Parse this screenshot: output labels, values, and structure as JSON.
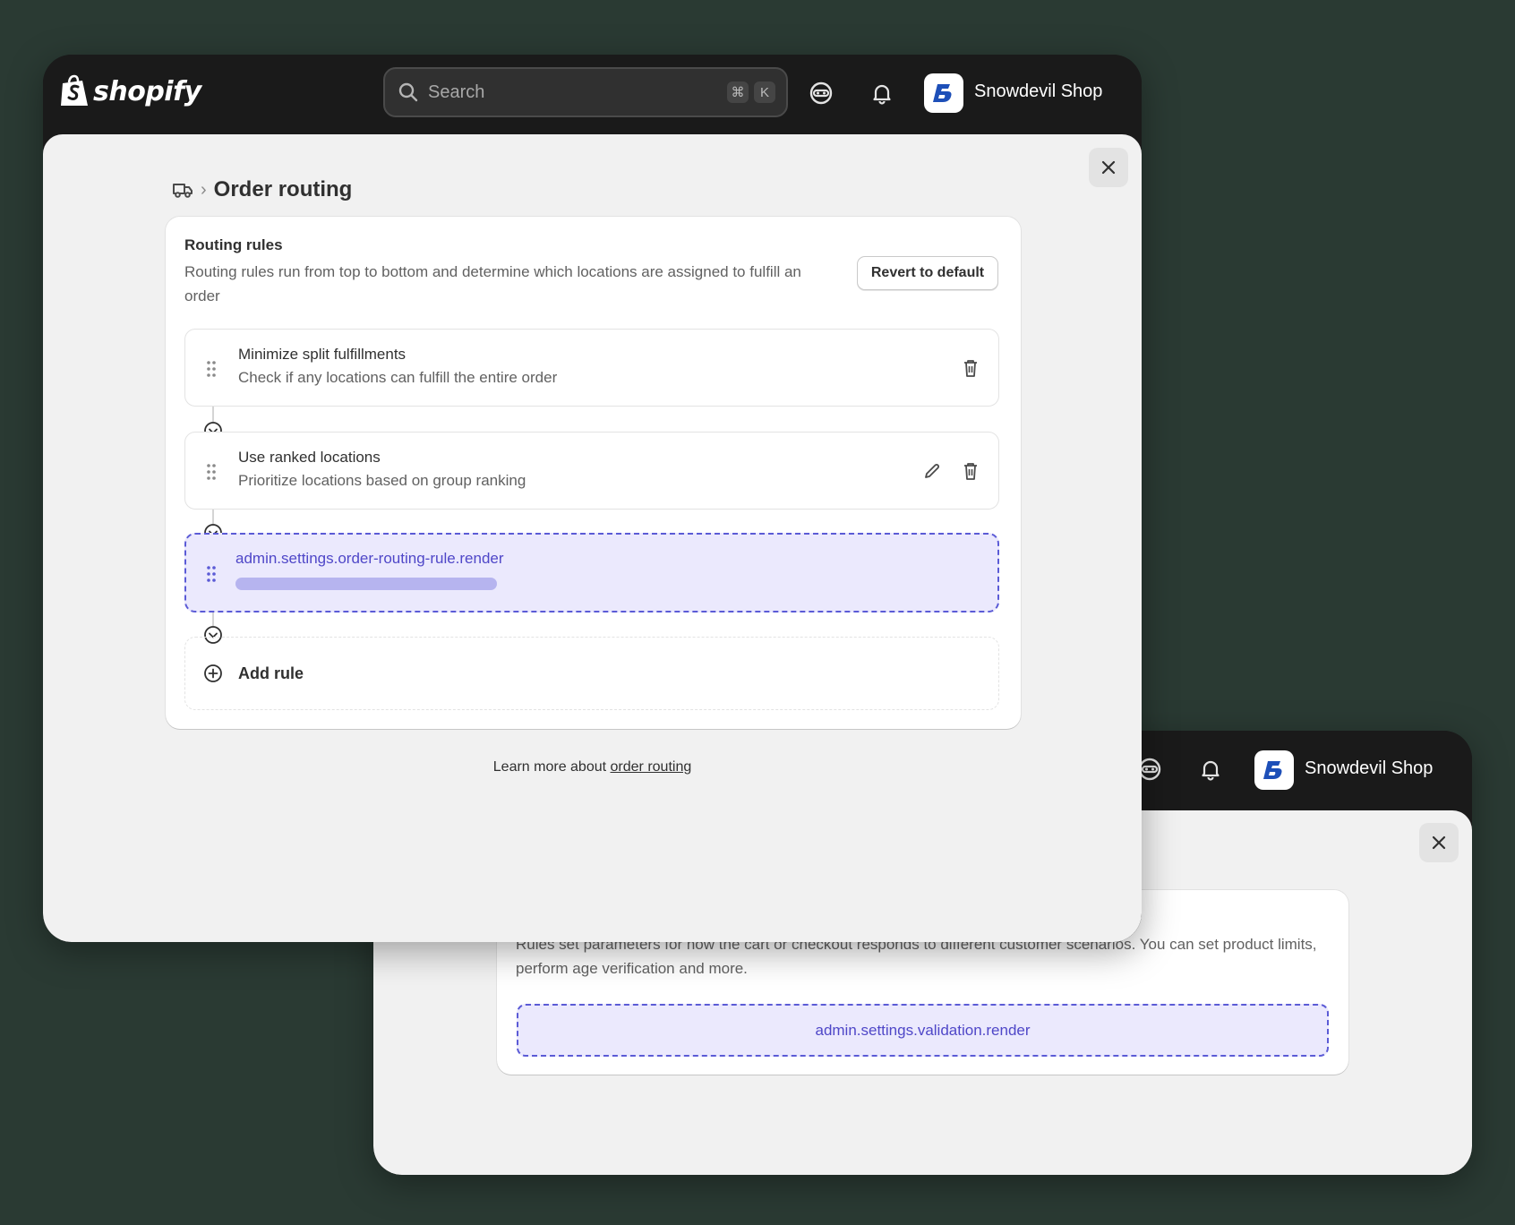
{
  "topbar": {
    "brand": "shopify",
    "search_placeholder": "Search",
    "shortcut_keys": [
      "⌘",
      "K"
    ],
    "shop_name": "Snowdevil Shop"
  },
  "order_routing": {
    "page_title": "Order routing",
    "card_title": "Routing rules",
    "card_description": "Routing rules run from top to bottom and determine which locations are assigned to fulfill an order",
    "revert_button": "Revert to default",
    "rules": [
      {
        "title": "Minimize split fulfillments",
        "subtitle": "Check if any locations can fulfill the entire order"
      },
      {
        "title": "Use ranked locations",
        "subtitle": "Prioritize locations based on group ranking"
      }
    ],
    "extension_rule": {
      "label": "admin.settings.order-routing-rule.render"
    },
    "add_rule": "Add rule",
    "learn_more_prefix": "Learn more about ",
    "learn_more_link": "order routing"
  },
  "validation": {
    "description": "Rules set parameters for how the cart or checkout responds to different customer scenarios. You can set product limits, perform age verification and more.",
    "extension_label": "admin.settings.validation.render"
  },
  "colors": {
    "background": "#2a3a33",
    "topbar": "#1a1a1a",
    "extension_accent": "#5b5bd6",
    "extension_fill": "#ebe9fd"
  }
}
